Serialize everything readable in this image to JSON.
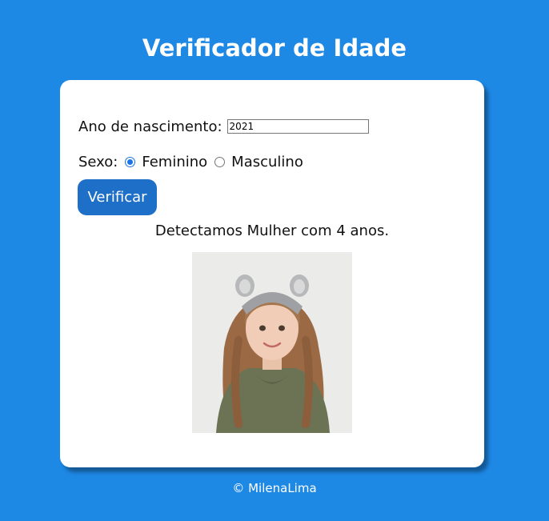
{
  "header": {
    "title": "Verificador de Idade"
  },
  "form": {
    "birth_year_label": "Ano de nascimento:",
    "birth_year_value": "2021",
    "sex_label": "Sexo:",
    "sex_options": [
      {
        "label": "Feminino",
        "selected": true
      },
      {
        "label": "Masculino",
        "selected": false
      }
    ],
    "verify_label": "Verificar"
  },
  "result": {
    "text": "Detectamos Mulher com 4 anos."
  },
  "footer": {
    "text": "© MilenaLima"
  }
}
